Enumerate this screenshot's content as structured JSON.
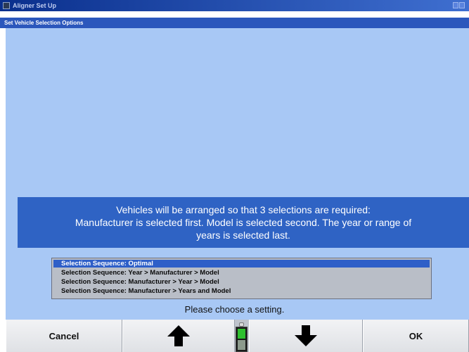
{
  "window": {
    "title": "Aligner Set Up",
    "subtitle": "Set Vehicle Selection Options"
  },
  "message": {
    "lines": [
      "Vehicles will be arranged so that 3 selections are required:",
      "Manufacturer is selected first.  Model is selected second.  The year or range of",
      "years is selected last."
    ]
  },
  "options": [
    "Selection Sequence: Optimal",
    "Selection Sequence: Year > Manufacturer > Model",
    "Selection Sequence: Manufacturer > Year > Model",
    "Selection Sequence: Manufacturer > Years and Model"
  ],
  "selected_index": 0,
  "prompt": "Please choose a setting.",
  "buttons": {
    "cancel": "Cancel",
    "up": "up-arrow-icon",
    "down": "down-arrow-icon",
    "ok": "OK"
  },
  "colors": {
    "content_bg": "#a8c8f5",
    "message_bg": "#2f63c4",
    "selection": "#2e5fc8",
    "indicator": "#2fc02f"
  }
}
